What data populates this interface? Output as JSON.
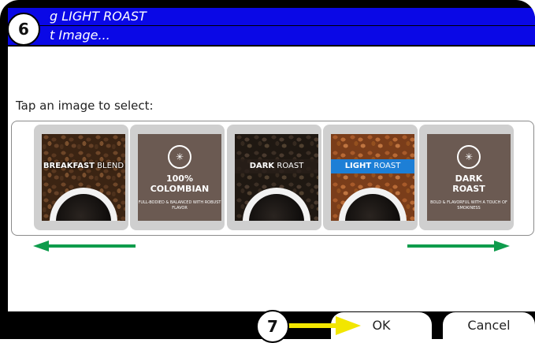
{
  "dialog": {
    "title": "g LIGHT ROAST",
    "subtitle": "t Image...",
    "prompt": "Tap an image to select:"
  },
  "images": [
    {
      "label_bold": "BREAKFAST",
      "label_light": " BLEND",
      "style": "beans-plain"
    },
    {
      "title": "100% COLOMBIAN",
      "subtitle": "FULL-BODIED & BALANCED WITH ROBUST FLAVOR",
      "style": "plain"
    },
    {
      "label_bold": "DARK",
      "label_light": " ROAST",
      "style": "beans-dark"
    },
    {
      "label_bold": "LIGHT",
      "label_light": " ROAST",
      "style": "beans-light"
    },
    {
      "title": "DARK ROAST",
      "subtitle": "BOLD & FLAVORFUL WITH A TOUCH OF SMOKINESS",
      "style": "plain"
    }
  ],
  "buttons": {
    "ok": "OK",
    "cancel": "Cancel"
  },
  "callouts": {
    "step6": "6",
    "step7": "7"
  },
  "colors": {
    "title_bar": "#0a08e6",
    "scroll_arrow": "#0e9c4c",
    "callout_arrow": "#f2e600",
    "light_roast_band": "#1d7fd6"
  }
}
